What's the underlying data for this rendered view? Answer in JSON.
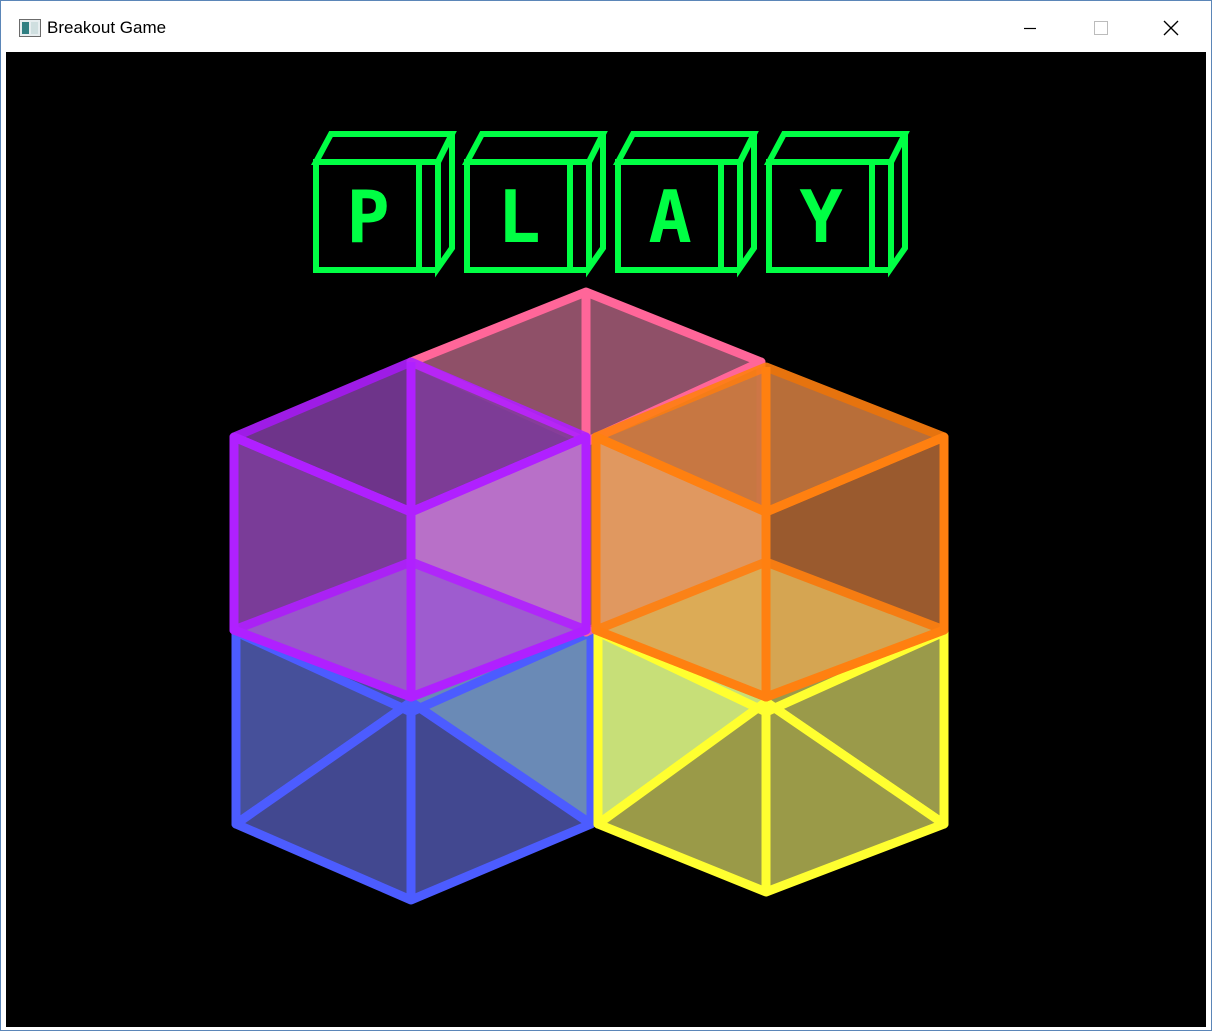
{
  "window": {
    "title": "Breakout Game",
    "icon": "app-window-icon",
    "controls": [
      "minimize-icon",
      "maximize-icon",
      "close-icon"
    ]
  },
  "menu": {
    "letters": [
      "P",
      "L",
      "A",
      "Y"
    ],
    "button_color": "#00ff44"
  },
  "artwork": {
    "cube_colors": {
      "pink": "#ff6699",
      "purple": "#b020ff",
      "orange": "#ff8010",
      "blue": "#4c5cff",
      "yellow": "#ffff30"
    }
  }
}
